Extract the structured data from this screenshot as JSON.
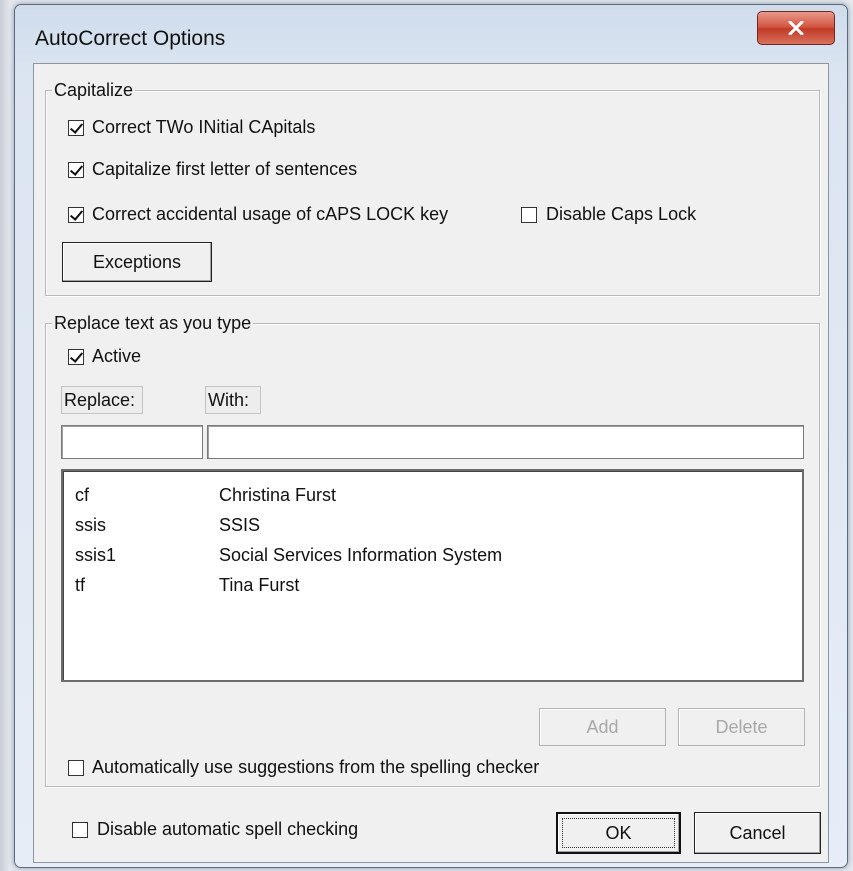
{
  "window": {
    "title": "AutoCorrect Options",
    "close_icon": "close-icon"
  },
  "capitalize": {
    "legend": "Capitalize",
    "two_initial": {
      "label": "Correct TWo INitial CApitals",
      "checked": true
    },
    "first_letter": {
      "label": "Capitalize first letter of sentences",
      "checked": true
    },
    "caps_lock": {
      "label": "Correct accidental usage of cAPS LOCK key",
      "checked": true
    },
    "disable_caps_lock": {
      "label": "Disable Caps Lock",
      "checked": false
    },
    "exceptions_button": "Exceptions"
  },
  "replace": {
    "legend": "Replace text as you type",
    "active": {
      "label": "Active",
      "checked": true
    },
    "replace_label": "Replace:",
    "with_label": "With:",
    "replace_value": "",
    "with_value": "",
    "entries": [
      {
        "replace": "cf",
        "with": "Christina Furst"
      },
      {
        "replace": "ssis",
        "with": "SSIS"
      },
      {
        "replace": "ssis1",
        "with": "Social Services Information System"
      },
      {
        "replace": "tf",
        "with": "Tina Furst"
      }
    ],
    "add_button": "Add",
    "delete_button": "Delete",
    "suggestions": {
      "label": "Automatically use suggestions from the spelling checker",
      "checked": false
    }
  },
  "footer": {
    "disable_spell": {
      "label": "Disable automatic spell checking",
      "checked": false
    },
    "ok_button": "OK",
    "cancel_button": "Cancel"
  },
  "colors": {
    "close_button": "#c94733",
    "window_frame": "#dbe5f1",
    "dialog_face": "#f0f0f0"
  }
}
